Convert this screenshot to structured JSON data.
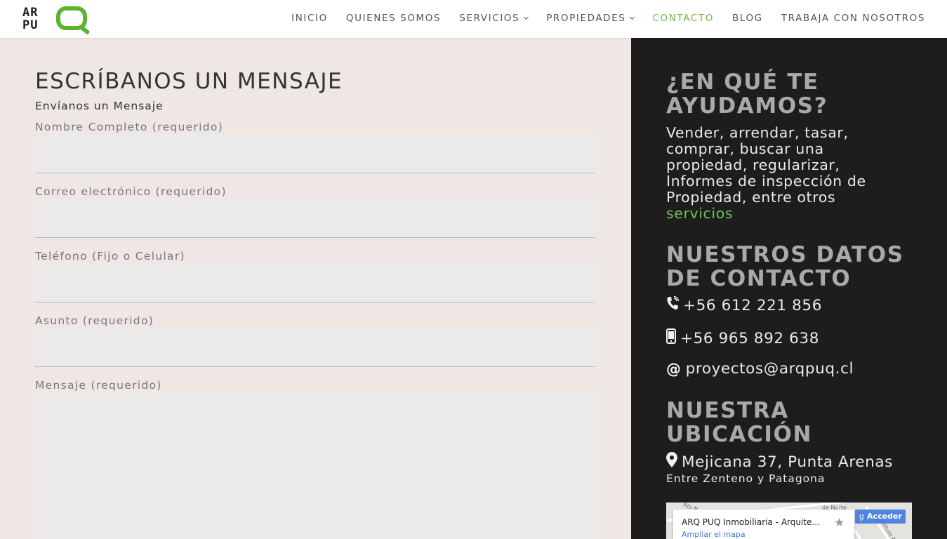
{
  "header": {
    "logo_line1": "AR",
    "logo_line2": "PU",
    "nav": [
      {
        "label": "INICIO"
      },
      {
        "label": "QUIENES SOMOS"
      },
      {
        "label": "SERVICIOS"
      },
      {
        "label": "PROPIEDADES"
      },
      {
        "label": "CONTACTO"
      },
      {
        "label": "BLOG"
      },
      {
        "label": "TRABAJA CON NOSOTROS"
      }
    ]
  },
  "form": {
    "title": "ESCRÍBANOS UN MENSAJE",
    "subtitle": "Envíanos un Mensaje",
    "fields": [
      {
        "label": "Nombre Completo (requerido)",
        "value": ""
      },
      {
        "label": "Correo electrónico (requerido)",
        "value": ""
      },
      {
        "label": "Teléfono (Fijo o Celular)",
        "value": ""
      },
      {
        "label": "Asunto (requerido)",
        "value": ""
      },
      {
        "label": "Mensaje (requerido)",
        "value": ""
      }
    ]
  },
  "sidebar": {
    "help_title": "¿EN QUÉ TE AYUDAMOS?",
    "help_text": "Vender, arrendar, tasar, comprar, buscar una propiedad, regularizar, Informes de inspección de Propiedad, entre otros",
    "help_link": "servicios",
    "contact_title": "NUESTROS DATOS DE CONTACTO",
    "phone": "+56 612 221 856",
    "mobile": "+56 965 892 638",
    "email": "proyectos@arqpuq.cl",
    "location_title": "NUESTRA UBICACIÓN",
    "address": "Mejicana 37, Punta Arenas",
    "address_detail": "Entre Zenteno y Patagona"
  },
  "map": {
    "place_name": "ARQ PUQ Inmobiliaria - Arquite...",
    "enlarge_link": "Ampliar el mapa",
    "signin_button": "Acceder",
    "street_1": "Río N",
    "street_2": "de Norte",
    "street_3": "Arturo P"
  },
  "colors": {
    "accent_green": "#74b84a",
    "logo_green": "#5cb531",
    "sidebar_bg": "#1f1d1c",
    "form_bg": "#efe7e4"
  }
}
